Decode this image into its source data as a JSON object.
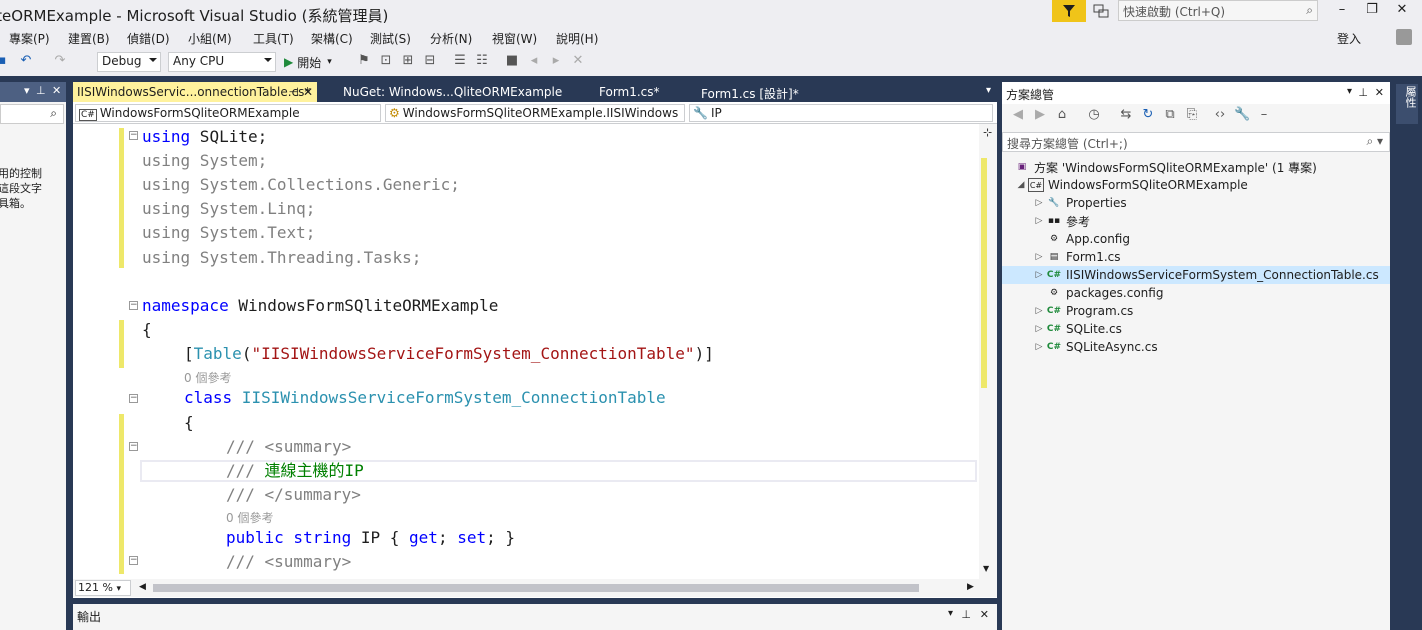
{
  "window": {
    "title": "iteORMExample - Microsoft Visual Studio (系統管理員)",
    "quick_launch_placeholder": "快速啟動 (Ctrl+Q)",
    "login": "登入"
  },
  "menu": [
    "專案(P)",
    "建置(B)",
    "偵錯(D)",
    "小組(M)",
    "工具(T)",
    "架構(C)",
    "測試(S)",
    "分析(N)",
    "視窗(W)",
    "說明(H)"
  ],
  "toolbar": {
    "config": "Debug",
    "platform": "Any CPU",
    "start": "開始"
  },
  "toolbox": {
    "text_lines": [
      "用的控制",
      "這段文字",
      "具箱。"
    ]
  },
  "editor": {
    "tabs": [
      {
        "label": "IISIWindowsServic...onnectionTable.cs*",
        "active": true
      },
      {
        "label": "NuGet: Windows...QliteORMExample",
        "active": false
      },
      {
        "label": "Form1.cs*",
        "active": false
      },
      {
        "label": "Form1.cs [設計]*",
        "active": false
      }
    ],
    "nav_project": "WindowsFormSQliteORMExample",
    "nav_class": "WindowsFormSQliteORMExample.IISIWindows",
    "nav_member": "IP",
    "zoom": "121 %",
    "code": {
      "l1_kw": "using",
      "l1_rest": " SQLite;",
      "l2_kw": "using",
      "l2_rest": " System;",
      "l3_kw": "using",
      "l3_rest": " System.Collections.Generic;",
      "l4_kw": "using",
      "l4_rest": " System.Linq;",
      "l5_kw": "using",
      "l5_rest": " System.Text;",
      "l6_kw": "using",
      "l6_rest": " System.Threading.Tasks;",
      "l7_kw": "namespace",
      "l7_rest": " WindowsFormSQliteORMExample",
      "l8": "{",
      "l9_a": "[",
      "l9_type": "Table",
      "l9_b": "(",
      "l9_str": "\"IISIWindowsServiceFormSystem_ConnectionTable\"",
      "l9_c": ")]",
      "ref1": "0 個參考",
      "l10_kw": "class",
      "l10_type": " IISIWindowsServiceFormSystem_ConnectionTable",
      "l11": "{",
      "l12_a": "/// ",
      "l12_b": "<summary>",
      "l13_a": "/// ",
      "l13_b": "連線主機的IP",
      "l14_a": "/// ",
      "l14_b": "</summary>",
      "ref2": "0 個參考",
      "l15_kw1": "public",
      "l15_kw2": " string",
      "l15_a": " IP { ",
      "l15_kw3": "get",
      "l15_b": "; ",
      "l15_kw4": "set",
      "l15_c": "; }",
      "l16_a": "/// ",
      "l16_b": "<summary>"
    }
  },
  "output": {
    "title": "輸出"
  },
  "solution_explorer": {
    "title": "方案總管",
    "search_placeholder": "搜尋方案總管 (Ctrl+;)",
    "nodes": [
      {
        "label": "方案 'WindowsFormSQliteORMExample' (1 專案)",
        "icon": "solution-icon"
      },
      {
        "label": "WindowsFormSQliteORMExample",
        "icon": "csproj-icon"
      },
      {
        "label": "Properties",
        "icon": "wrench-icon"
      },
      {
        "label": "參考",
        "icon": "references-icon"
      },
      {
        "label": "App.config",
        "icon": "config-icon"
      },
      {
        "label": "Form1.cs",
        "icon": "form-icon"
      },
      {
        "label": "IISIWindowsServiceFormSystem_ConnectionTable.cs",
        "icon": "csharp-file-icon"
      },
      {
        "label": "packages.config",
        "icon": "config-icon"
      },
      {
        "label": "Program.cs",
        "icon": "csharp-file-icon"
      },
      {
        "label": "SQLite.cs",
        "icon": "csharp-file-icon"
      },
      {
        "label": "SQLiteAsync.cs",
        "icon": "csharp-file-icon"
      }
    ]
  },
  "right_strip": {
    "tab": "屬性"
  },
  "colors": {
    "accent": "#293955",
    "active_tab": "#fff29d",
    "change_bar": "#eee86a"
  }
}
